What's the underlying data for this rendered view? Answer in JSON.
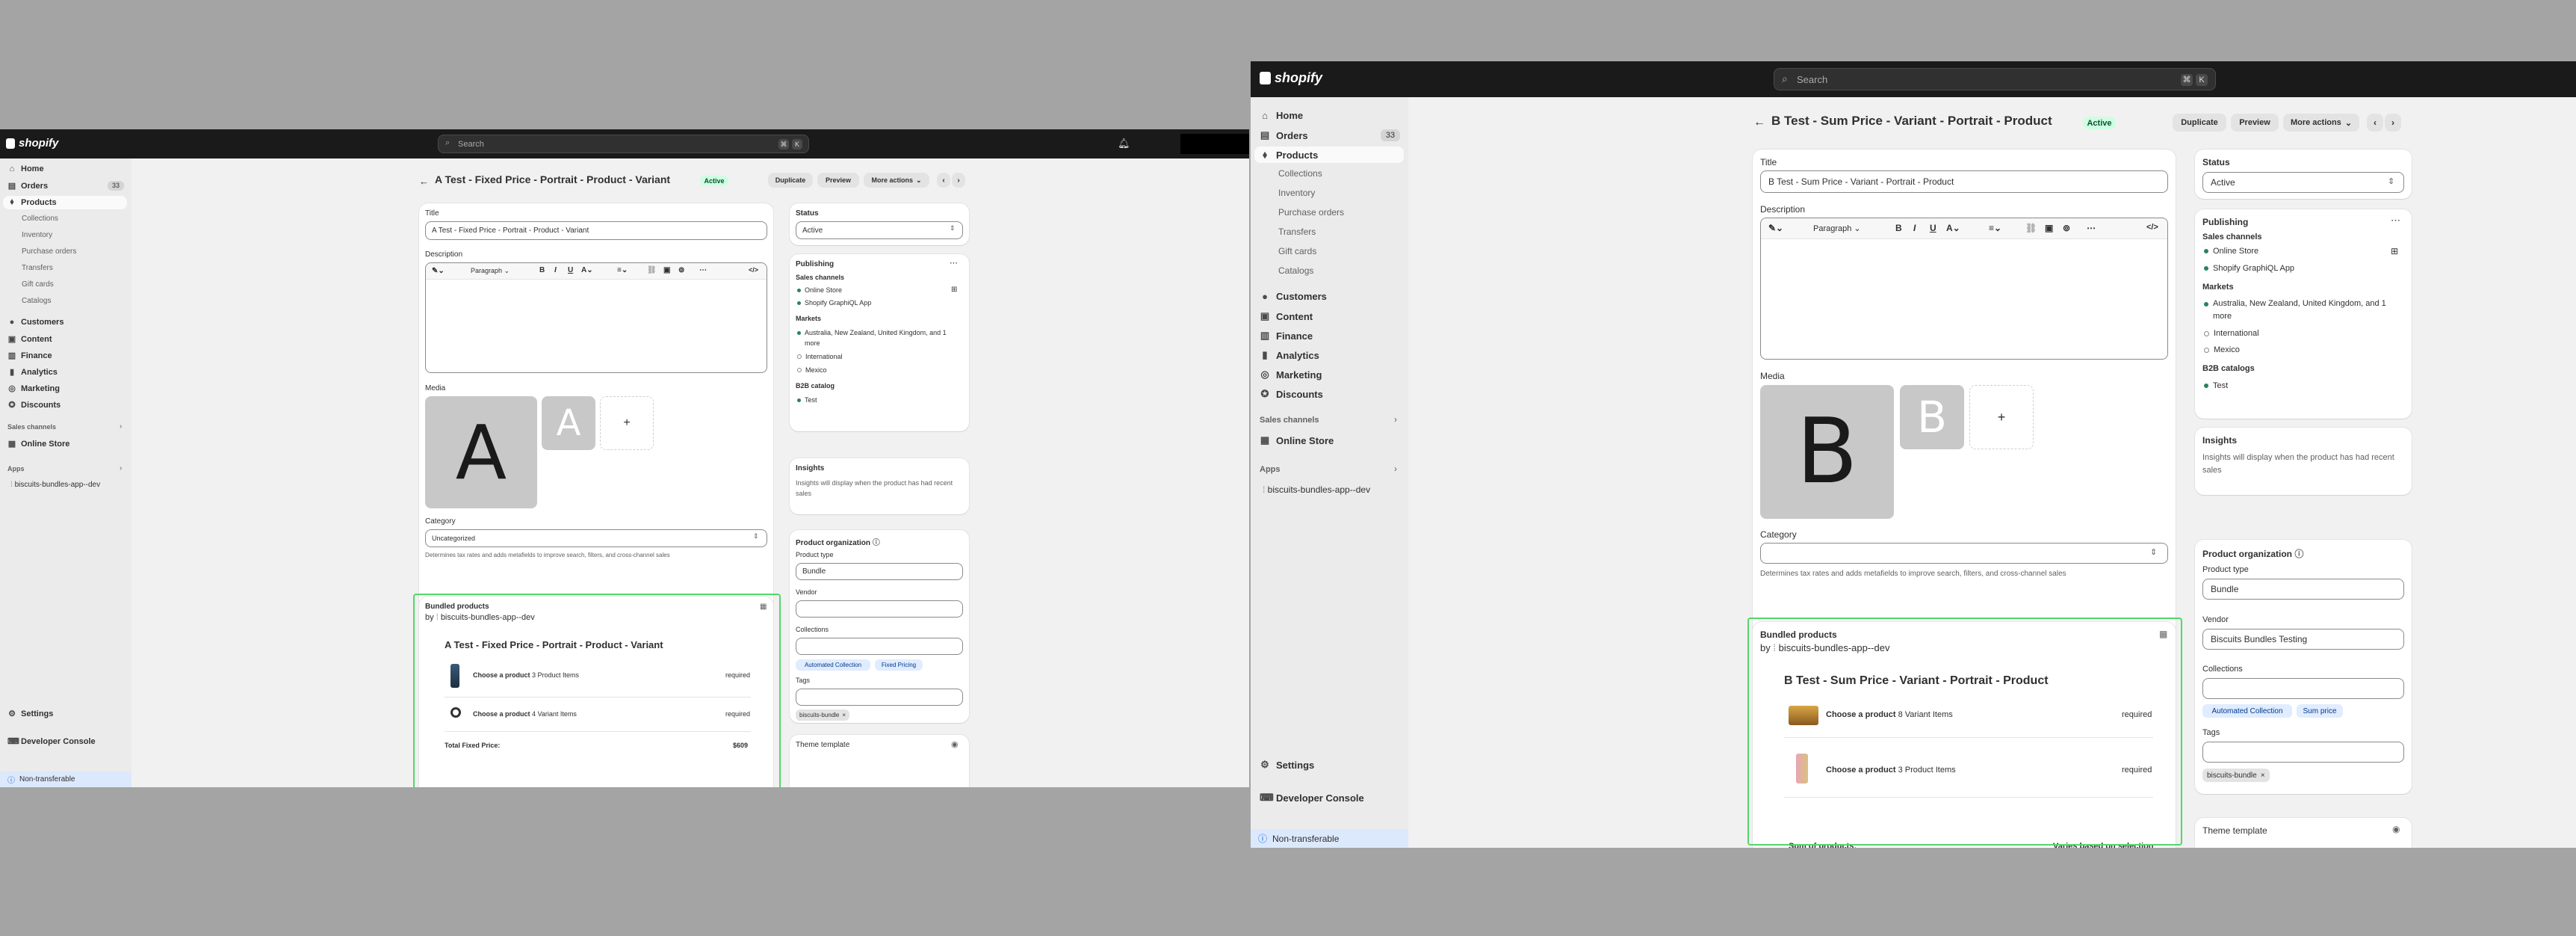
{
  "common": {
    "logo_text": "shopify",
    "search_placeholder": "Search",
    "search_kbd": [
      "⌘",
      "K"
    ],
    "nav": {
      "home": "Home",
      "orders": "Orders",
      "orders_count": "33",
      "products": "Products",
      "collections": "Collections",
      "inventory": "Inventory",
      "purchase_orders": "Purchase orders",
      "transfers": "Transfers",
      "gift_cards": "Gift cards",
      "catalogs": "Catalogs",
      "customers": "Customers",
      "content": "Content",
      "finance": "Finance",
      "analytics": "Analytics",
      "marketing": "Marketing",
      "discounts": "Discounts",
      "sales_channels": "Sales channels",
      "online_store": "Online Store",
      "apps": "Apps",
      "app_name": "biscuits-bundles-app--dev",
      "settings": "Settings",
      "developer_console": "Developer Console",
      "non_transferable": "Non-transferable"
    },
    "buttons": {
      "duplicate": "Duplicate",
      "preview": "Preview",
      "more_actions": "More actions"
    },
    "status_badge": "Active",
    "labels": {
      "title": "Title",
      "description": "Description",
      "media": "Media",
      "category": "Category",
      "category_help": "Determines tax rates and adds metafields to improve search, filters, and cross-channel sales",
      "status": "Status",
      "status_value": "Active",
      "publishing": "Publishing",
      "sales_channels": "Sales channels",
      "markets": "Markets",
      "b2b_catalogs": "B2B catalogs",
      "b2b_catalog": "B2B catalog",
      "insights": "Insights",
      "insights_text": "Insights will display when the product has had recent sales",
      "product_organization": "Product organization",
      "product_type": "Product type",
      "vendor": "Vendor",
      "collections": "Collections",
      "tags": "Tags",
      "theme_template": "Theme template",
      "bundled_products": "Bundled products",
      "by": "by",
      "choose_product": "Choose a product",
      "required": "required",
      "paragraph": "Paragraph"
    },
    "channels": [
      "Online Store",
      "Shopify GraphiQL App"
    ],
    "markets": [
      "Australia, New Zealand, United Kingdom, and 1 more",
      "International",
      "Mexico"
    ],
    "b2b": "Test",
    "tag_value": "biscuits-bundle",
    "product_type_value": "Bundle"
  },
  "pane_a": {
    "page_title": "A Test - Fixed Price - Portrait - Product - Variant",
    "title_value": "A Test - Fixed Price - Portrait - Product - Variant",
    "media_letter": "A",
    "category_value": "Uncategorized",
    "vendor_value": "",
    "collections_pills": [
      "Automated Collection",
      "Fixed Pricing"
    ],
    "bundle_title": "A Test - Fixed Price - Portrait - Product - Variant",
    "bundle_rows": [
      {
        "count": "3 Product Items",
        "req": "required"
      },
      {
        "count": "4 Variant Items",
        "req": "required"
      }
    ],
    "total_label": "Total Fixed Price:",
    "total_value": "$609"
  },
  "pane_b": {
    "page_title": "B Test - Sum Price - Variant - Portrait - Product",
    "title_value": "B Test - Sum Price - Variant - Portrait - Product",
    "media_letter": "B",
    "category_value": "",
    "vendor_value": "Biscuits Bundles Testing",
    "collections_pills": [
      "Automated Collection",
      "Sum price"
    ],
    "bundle_title": "B Test - Sum Price - Variant - Portrait - Product",
    "bundle_rows": [
      {
        "count": "8 Variant Items",
        "req": "required"
      },
      {
        "count": "3 Product Items",
        "req": "required"
      }
    ],
    "total_label": "Sum of products:",
    "total_value": "Varies based on selection"
  }
}
